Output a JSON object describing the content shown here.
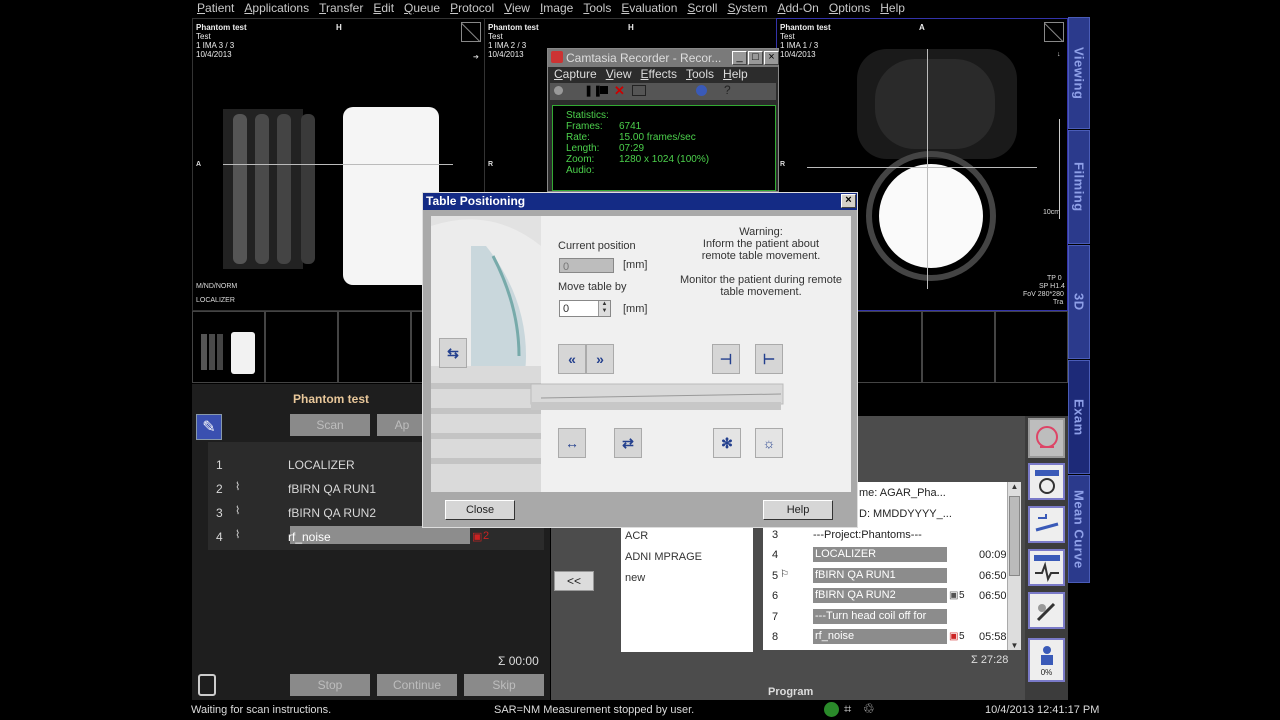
{
  "menu": [
    "Patient",
    "Applications",
    "Transfer",
    "Edit",
    "Queue",
    "Protocol",
    "View",
    "Image",
    "Tools",
    "Evaluation",
    "Scroll",
    "System",
    "Add-On",
    "Options",
    "Help"
  ],
  "right_tabs": [
    "Viewing",
    "Filming",
    "3D",
    "Exam",
    "Mean Curve"
  ],
  "viewports": [
    {
      "name": "Phantom test",
      "sub": "Test",
      "ima": "1 IMA 3 / 3",
      "date": "10/4/2013",
      "orient": "H",
      "left_label": "A",
      "bottom_a": "M/ND/NORM",
      "bottom_b": "LOCALIZER"
    },
    {
      "name": "Phantom test",
      "sub": "Test",
      "ima": "1 IMA 2 / 3",
      "date": "10/4/2013",
      "orient": "H",
      "left_label": "R"
    },
    {
      "name": "Phantom test",
      "sub": "Test",
      "ima": "1 IMA 1 / 3",
      "date": "10/4/2013",
      "orient": "A",
      "left_label": "R",
      "scale": "10cm",
      "tp": "TP 0",
      "sp": "SP H1.4",
      "fov": "FoV 280*280",
      "tra": "Tra"
    }
  ],
  "camtasia": {
    "title": "Camtasia Recorder - Recor...",
    "menu": [
      "Capture",
      "View",
      "Effects",
      "Tools",
      "Help"
    ],
    "stats_header": "Statistics:",
    "rows": [
      {
        "label": "Frames:",
        "value": "6741"
      },
      {
        "label": "Rate:",
        "value": "15.00 frames/sec"
      },
      {
        "label": "Length:",
        "value": "07:29"
      },
      {
        "label": "Zoom:",
        "value": "1280 x 1024 (100%)"
      },
      {
        "label": "Audio:",
        "value": ""
      }
    ]
  },
  "ctrl": {
    "patient": "Phantom test",
    "scan": "Scan",
    "apply": "Ap",
    "queue": [
      {
        "n": "1",
        "label": "LOCALIZER",
        "wave": ""
      },
      {
        "n": "2",
        "label": "fBIRN QA RUN1",
        "wave": "⌇"
      },
      {
        "n": "3",
        "label": "fBIRN QA RUN2",
        "wave": "⌇"
      },
      {
        "n": "4",
        "label": "rf_noise",
        "wave": "⌇",
        "badge": "2"
      }
    ],
    "time": "Σ 00:00",
    "stop": "Stop",
    "continue": "Continue",
    "skip": "Skip"
  },
  "tp": {
    "title": "Table Positioning",
    "current_label": "Current position",
    "current_value": "0",
    "unit": "[mm]",
    "move_label": "Move table by",
    "move_value": "0",
    "warn_title": "Warning:",
    "warn_1": "Inform the patient about",
    "warn_2": "remote table movement.",
    "warn_3": "Monitor the patient during remote",
    "warn_4": "table movement.",
    "back": "«",
    "fwd": "»",
    "close": "Close",
    "help": "Help"
  },
  "program": {
    "left_items": [
      "ACR",
      "ADNI MPRAGE",
      "new"
    ],
    "collapse": "<<",
    "rows": [
      {
        "n": "",
        "text": "me: AGAR_Pha...",
        "kind": "plain"
      },
      {
        "n": "",
        "text": "D: MMDDYYYY_...",
        "kind": "plain"
      },
      {
        "n": "3",
        "text": "---Project:Phantoms---",
        "kind": "plain"
      },
      {
        "n": "4",
        "text": "LOCALIZER",
        "kind": "bar",
        "time": "00:09"
      },
      {
        "n": "5",
        "text": "fBIRN QA RUN1",
        "kind": "bar",
        "time": "06:50"
      },
      {
        "n": "6",
        "text": "fBIRN QA RUN2",
        "kind": "bar",
        "time": "06:50",
        "badge": "5"
      },
      {
        "n": "7",
        "text": "---Turn head coil off for rf_...",
        "kind": "bar"
      },
      {
        "n": "8",
        "text": "rf_noise",
        "kind": "bar",
        "time": "05:58",
        "badge": "5"
      }
    ],
    "total": "Σ 27:28",
    "footer": "Program"
  },
  "tools_pct": "0%",
  "status": {
    "left": "Waiting for scan instructions.",
    "mid": "SAR=NM Measurement stopped by user.",
    "right": "10/4/2013 12:41:17 PM"
  },
  "colors": {
    "tab_blue": "#2b3a8c",
    "title_blue": "#142b85",
    "green": "#4cd14c"
  }
}
